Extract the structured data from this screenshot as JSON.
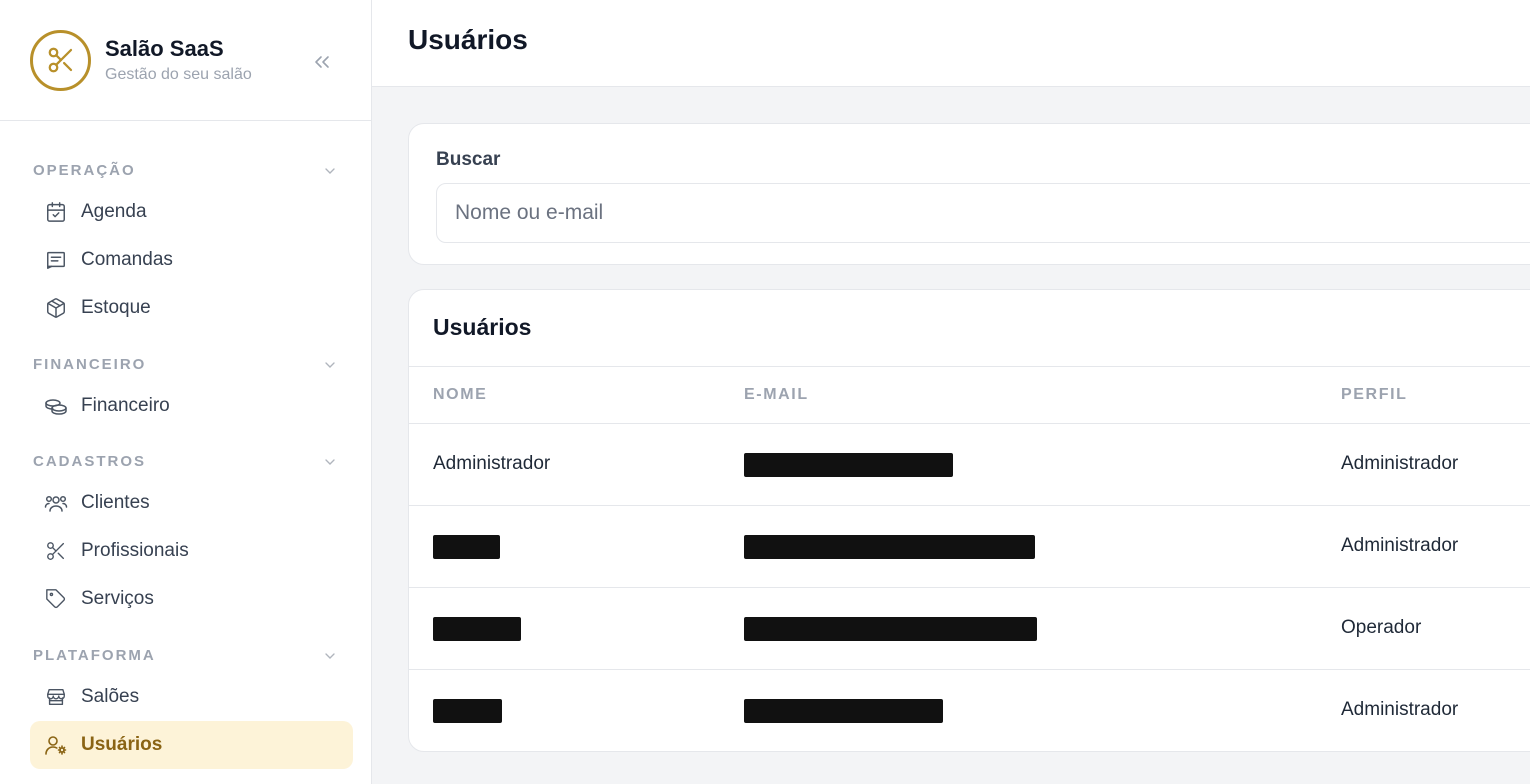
{
  "brand": {
    "title": "Salão SaaS",
    "subtitle": "Gestão do seu salão",
    "accent": "#b8902a",
    "logo_icon": "scissors-icon",
    "collapse_icon": "chevrons-left-icon"
  },
  "sidebar": {
    "sections": [
      {
        "label": "OPERAÇÃO",
        "items": [
          {
            "label": "Agenda",
            "icon": "calendar-check-icon"
          },
          {
            "label": "Comandas",
            "icon": "receipt-icon"
          },
          {
            "label": "Estoque",
            "icon": "box-icon"
          }
        ]
      },
      {
        "label": "FINANCEIRO",
        "items": [
          {
            "label": "Financeiro",
            "icon": "coins-icon"
          }
        ]
      },
      {
        "label": "CADASTROS",
        "items": [
          {
            "label": "Clientes",
            "icon": "users-icon"
          },
          {
            "label": "Profissionais",
            "icon": "scissors-icon"
          },
          {
            "label": "Serviços",
            "icon": "tag-icon"
          }
        ]
      },
      {
        "label": "PLATAFORMA",
        "items": [
          {
            "label": "Salões",
            "icon": "store-icon"
          },
          {
            "label": "Usuários",
            "icon": "user-cog-icon",
            "active": true
          }
        ]
      }
    ],
    "active_bg": "#fdf3d8",
    "active_color": "#8a6414"
  },
  "header": {
    "title": "Usuários"
  },
  "search": {
    "label": "Buscar",
    "placeholder": "Nome ou e-mail",
    "value": ""
  },
  "table": {
    "title": "Usuários",
    "columns": [
      "NOME",
      "E-MAIL",
      "PERFIL"
    ],
    "rows": [
      {
        "nome": "Administrador",
        "email": "[redacted]",
        "perfil": "Administrador"
      },
      {
        "nome": "[redacted]",
        "email": "[redacted]",
        "perfil": "Administrador"
      },
      {
        "nome": "[redacted]",
        "email": "[redacted]",
        "perfil": "Operador"
      },
      {
        "nome": "[redacted]",
        "email": "[redacted]",
        "perfil": "Administrador"
      }
    ]
  }
}
